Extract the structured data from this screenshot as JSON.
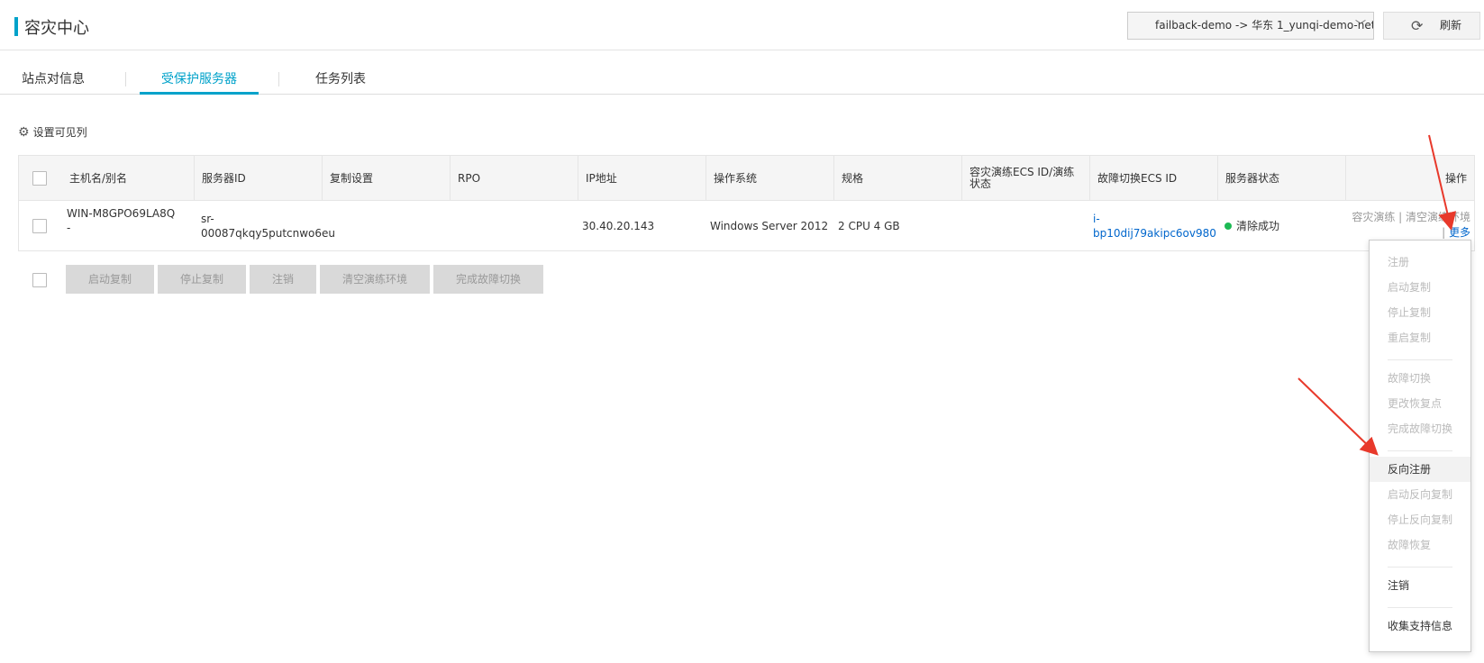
{
  "header": {
    "title": "容灾中心",
    "site_pair": "failback-demo -> 华东 1_yunqi-demo-net",
    "refresh_label": "刷新",
    "refresh_icon": "refresh-icon"
  },
  "tabs": [
    {
      "label": "站点对信息",
      "active": false
    },
    {
      "label": "受保护服务器",
      "active": true
    },
    {
      "label": "任务列表",
      "active": false
    }
  ],
  "settings_label": "设置可见列",
  "columns": [
    "主机名/别名",
    "服务器ID",
    "复制设置",
    "RPO",
    "IP地址",
    "操作系统",
    "规格",
    "容灾演练ECS ID/演练状态",
    "故障切换ECS ID",
    "服务器状态",
    "操作"
  ],
  "row": {
    "hostname": "WIN-M8GPO69LA8Q",
    "alias": "-",
    "server_id_line1": "sr-",
    "server_id_line2": "00087qkqy5putcnwo6eu",
    "replication": "",
    "rpo": "",
    "ip": "30.40.20.143",
    "os": "Windows Server 2012",
    "spec": "2 CPU 4 GB",
    "drill": "",
    "failover_ecs": "i-bp10dij79akipc6ov980",
    "status": "清除成功",
    "status_color": "#1db954",
    "ops_line1": "容灾演练 | 清空演练环境",
    "ops_sep": "|",
    "ops_more": "更多"
  },
  "bulk_actions": [
    "启动复制",
    "停止复制",
    "注销",
    "清空演练环境",
    "完成故障切换"
  ],
  "more_menu": {
    "group1": [
      "注册",
      "启动复制",
      "停止复制",
      "重启复制"
    ],
    "group2": [
      "故障切换",
      "更改恢复点",
      "完成故障切换"
    ],
    "group3": [
      "反向注册",
      "启动反向复制",
      "停止反向复制",
      "故障恢复"
    ],
    "group4": [
      "注销"
    ],
    "group5": [
      "收集支持信息"
    ]
  },
  "colors": {
    "accent": "#00a2ca",
    "link": "#0066cc",
    "annotation_arrow": "#e8392b"
  }
}
